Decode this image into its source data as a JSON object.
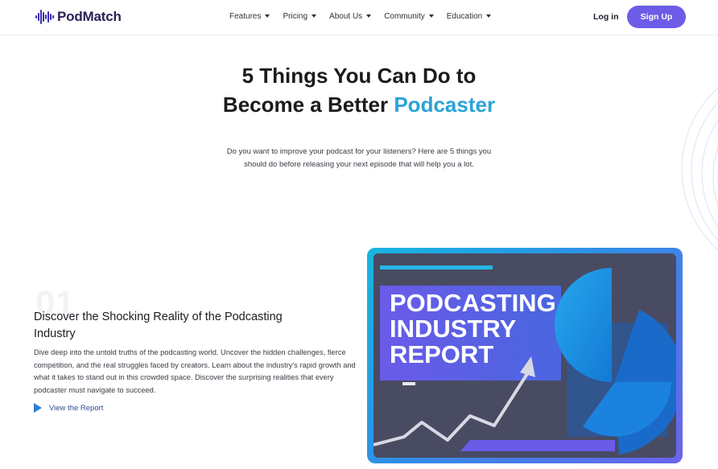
{
  "brand": {
    "name_part1": "Pod",
    "name_part2": "Match",
    "colors": {
      "primary": "#6c5ce7",
      "accent": "#2aa3d8",
      "logo_icon": "#3a2fb0",
      "dark": "#1b1b1f"
    }
  },
  "nav": {
    "items": [
      {
        "label": "Features"
      },
      {
        "label": "Pricing"
      },
      {
        "label": "About Us"
      },
      {
        "label": "Community"
      },
      {
        "label": "Education"
      }
    ],
    "login_label": "Log in",
    "signup_label": "Sign Up"
  },
  "hero": {
    "title_line1": "5 Things You Can Do to",
    "title_line2_plain": "Become a Better ",
    "title_line2_accent": "Podcaster",
    "subtitle_line1": "Do you want to improve your podcast for your listeners? Here are 5 things you",
    "subtitle_line2": "should do before releasing your next episode that will help you a lot."
  },
  "article": {
    "number": "01",
    "title": "Discover the Shocking Reality of the Podcasting Industry",
    "body": "Dive deep into the untold truths of the podcasting world. Uncover the hidden challenges, fierce competition, and the real struggles faced by creators. Learn about the industry's rapid growth and what it takes to stand out in this crowded space. Discover the surprising realities that every podcaster must navigate to succeed.",
    "link_label": "View the Report"
  },
  "report_image": {
    "line1": "PODCASTING",
    "line2": "INDUSTRY",
    "line3": "REPORT"
  }
}
